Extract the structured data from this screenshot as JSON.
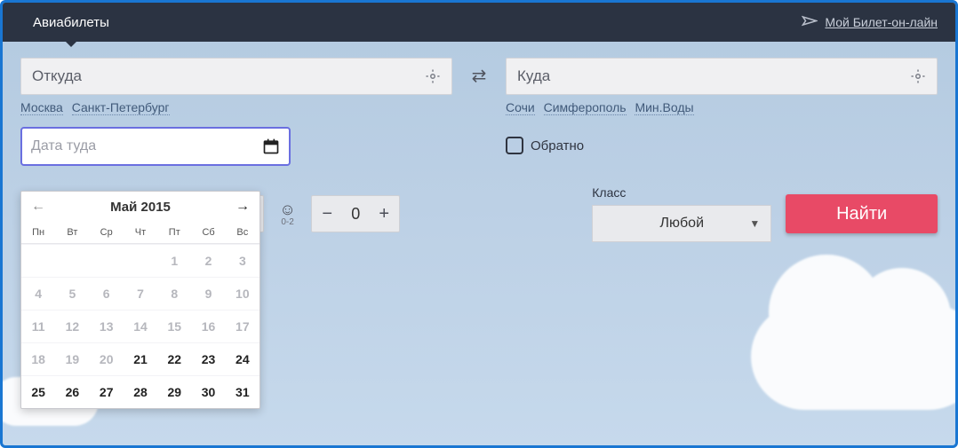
{
  "header": {
    "tab_title": "Авиабилеты",
    "my_ticket_label": "Мой Билет-он-лайн"
  },
  "from": {
    "placeholder": "Откуда",
    "quick": [
      "Москва",
      "Санкт-Петербург"
    ]
  },
  "to": {
    "placeholder": "Куда",
    "quick": [
      "Сочи",
      "Симферополь",
      "Мин.Воды"
    ]
  },
  "depart": {
    "placeholder": "Дата туда"
  },
  "return_label": "Обратно",
  "pax": {
    "baby_sub": "0-2",
    "baby_count": "0"
  },
  "class": {
    "label": "Класс",
    "selected": "Любой"
  },
  "search_label": "Найти",
  "calendar": {
    "title": "Май 2015",
    "dow": [
      "Пн",
      "Вт",
      "Ср",
      "Чт",
      "Пт",
      "Сб",
      "Вс"
    ],
    "lead_blanks": 4,
    "cells": [
      {
        "n": 1,
        "en": false
      },
      {
        "n": 2,
        "en": false
      },
      {
        "n": 3,
        "en": false
      },
      {
        "n": 4,
        "en": false
      },
      {
        "n": 5,
        "en": false
      },
      {
        "n": 6,
        "en": false
      },
      {
        "n": 7,
        "en": false
      },
      {
        "n": 8,
        "en": false
      },
      {
        "n": 9,
        "en": false
      },
      {
        "n": 10,
        "en": false
      },
      {
        "n": 11,
        "en": false
      },
      {
        "n": 12,
        "en": false
      },
      {
        "n": 13,
        "en": false
      },
      {
        "n": 14,
        "en": false
      },
      {
        "n": 15,
        "en": false
      },
      {
        "n": 16,
        "en": false
      },
      {
        "n": 17,
        "en": false
      },
      {
        "n": 18,
        "en": false
      },
      {
        "n": 19,
        "en": false
      },
      {
        "n": 20,
        "en": false
      },
      {
        "n": 21,
        "en": true
      },
      {
        "n": 22,
        "en": true
      },
      {
        "n": 23,
        "en": true
      },
      {
        "n": 24,
        "en": true
      },
      {
        "n": 25,
        "en": true
      },
      {
        "n": 26,
        "en": true
      },
      {
        "n": 27,
        "en": true
      },
      {
        "n": 28,
        "en": true
      },
      {
        "n": 29,
        "en": true
      },
      {
        "n": 30,
        "en": true
      },
      {
        "n": 31,
        "en": true
      }
    ]
  }
}
